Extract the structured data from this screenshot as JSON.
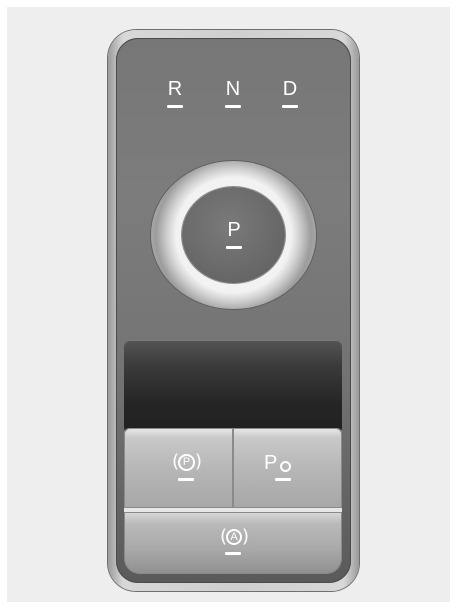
{
  "shifter": {
    "gears": {
      "reverse": "R",
      "neutral": "N",
      "drive": "D",
      "park": "P"
    }
  },
  "buttons": {
    "epb": {
      "icon": "parking-brake-icon",
      "glyph": "P"
    },
    "auto_hold": {
      "icon": "auto-hold-icon",
      "glyph": "A"
    },
    "park_hold": {
      "icon": "park-hold-icon",
      "glyph": "P"
    }
  },
  "colors": {
    "panel": "#777777",
    "indicator": "#ffffff",
    "dial_ring": "#e6e6e6",
    "button": "#b7b7b7"
  }
}
